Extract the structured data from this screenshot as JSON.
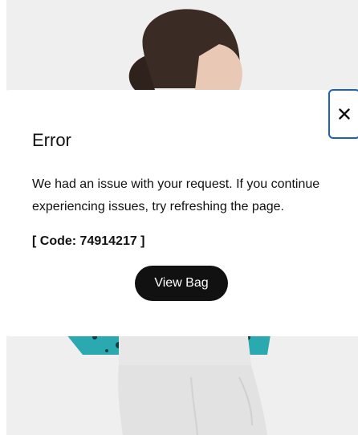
{
  "modal": {
    "title": "Error",
    "message": "We had an issue with your request. If you continue experiencing issues, try refreshing the page.",
    "code": "[ Code: 74914217 ]",
    "primary_button_label": "View Bag",
    "close_icon": "close-icon"
  },
  "background": {
    "image": "product photo of a model wearing a light grey hoodie with teal leopard print and grey sweatpants"
  },
  "colors": {
    "button_bg": "#111111",
    "button_text": "#ffffff",
    "focus_ring": "#1f5fbf",
    "photo_bg": "#efefef",
    "accent_teal": "#2aa9b0"
  }
}
